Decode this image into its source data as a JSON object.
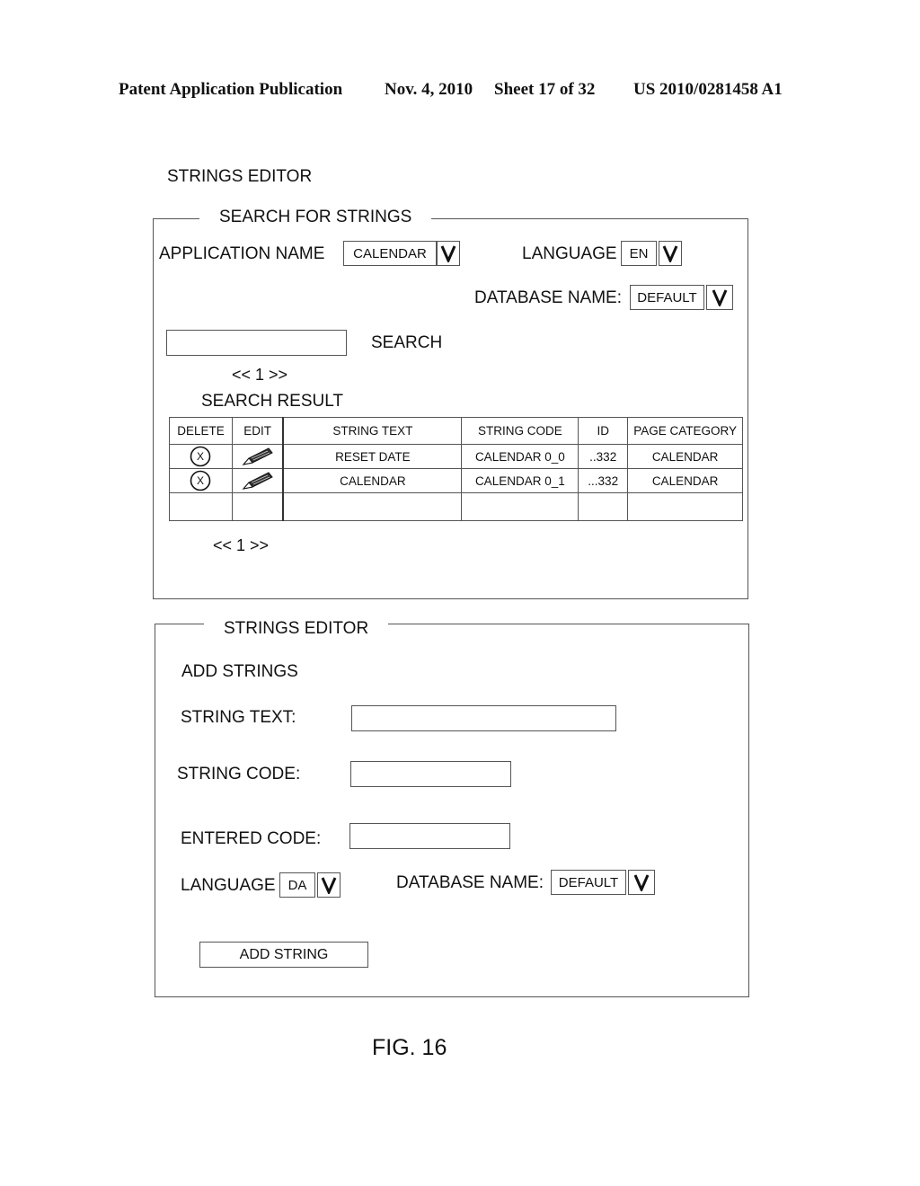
{
  "header": {
    "publication": "Patent Application Publication",
    "date": "Nov. 4, 2010",
    "sheet": "Sheet 17 of 32",
    "number": "US 2010/0281458 A1"
  },
  "page_title": "STRINGS EDITOR",
  "search_panel": {
    "legend": "SEARCH FOR STRINGS",
    "application_name_label": "APPLICATION NAME",
    "application_name_value": "CALENDAR",
    "language_label": "LANGUAGE",
    "language_value": "EN",
    "database_name_label": "DATABASE NAME:",
    "database_name_value": "DEFAULT",
    "search_input_value": "",
    "search_label": "SEARCH",
    "pager_top": "<< 1 >>",
    "result_title": "SEARCH RESULT",
    "table": {
      "columns": [
        "DELETE",
        "EDIT",
        "STRING TEXT",
        "STRING CODE",
        "ID",
        "PAGE CATEGORY"
      ],
      "rows": [
        {
          "delete_icon": "delete-circle-x-icon",
          "edit_icon": "pencil-icon",
          "string_text": "RESET DATE",
          "string_code": "CALENDAR 0_0",
          "id": "..332",
          "page_category": "CALENDAR"
        },
        {
          "delete_icon": "delete-circle-x-icon",
          "edit_icon": "pencil-icon",
          "string_text": "CALENDAR",
          "string_code": "CALENDAR 0_1",
          "id": "...332",
          "page_category": "CALENDAR"
        }
      ]
    },
    "pager_bottom": "<< 1 >>"
  },
  "editor_panel": {
    "legend": "STRINGS EDITOR",
    "add_title": "ADD STRINGS",
    "string_text_label": "STRING TEXT:",
    "string_text_value": "",
    "string_code_label": "STRING CODE:",
    "string_code_value": "",
    "entered_code_label": "ENTERED CODE:",
    "entered_code_value": "",
    "language_label": "LANGUAGE",
    "language_value": "DA",
    "database_name_label": "DATABASE NAME:",
    "database_name_value": "DEFAULT",
    "add_button": "ADD STRING"
  },
  "figure_caption": "FIG. 16",
  "icons": {
    "dropdown": "chevron-v-icon",
    "delete": "circle-x-icon",
    "edit": "pencil-icon"
  }
}
